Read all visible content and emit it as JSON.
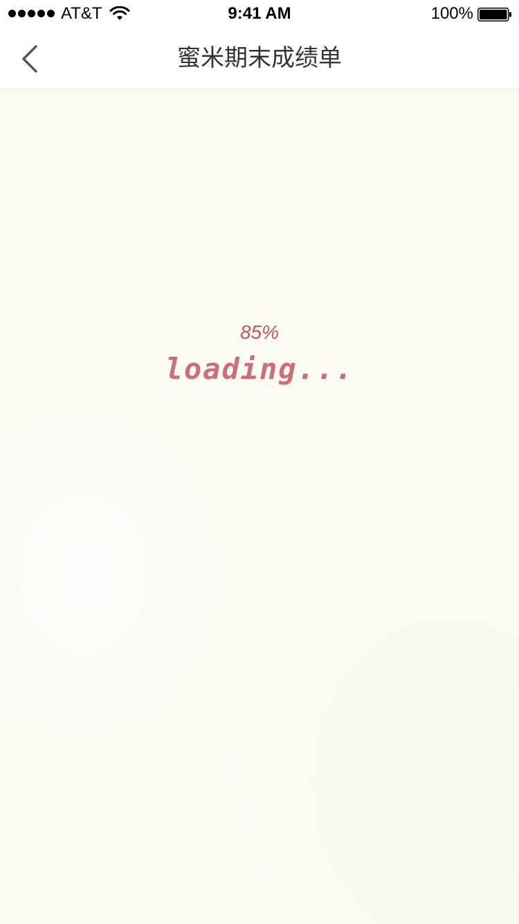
{
  "status_bar": {
    "carrier": "AT&T",
    "time": "9:41 AM",
    "battery": "100%",
    "icons": [
      "signal-dots-icon",
      "wifi-icon",
      "battery-icon"
    ]
  },
  "nav": {
    "title": "蜜米期末成绩单",
    "back_icon": "chevron-left-icon"
  },
  "loader": {
    "percent_text": "85%",
    "progress": 0.85,
    "label": "loading...",
    "color": "#c05763"
  },
  "colors": {
    "background": "#fbfbf3",
    "nav_background": "#ffffff",
    "title_color": "#333333"
  }
}
